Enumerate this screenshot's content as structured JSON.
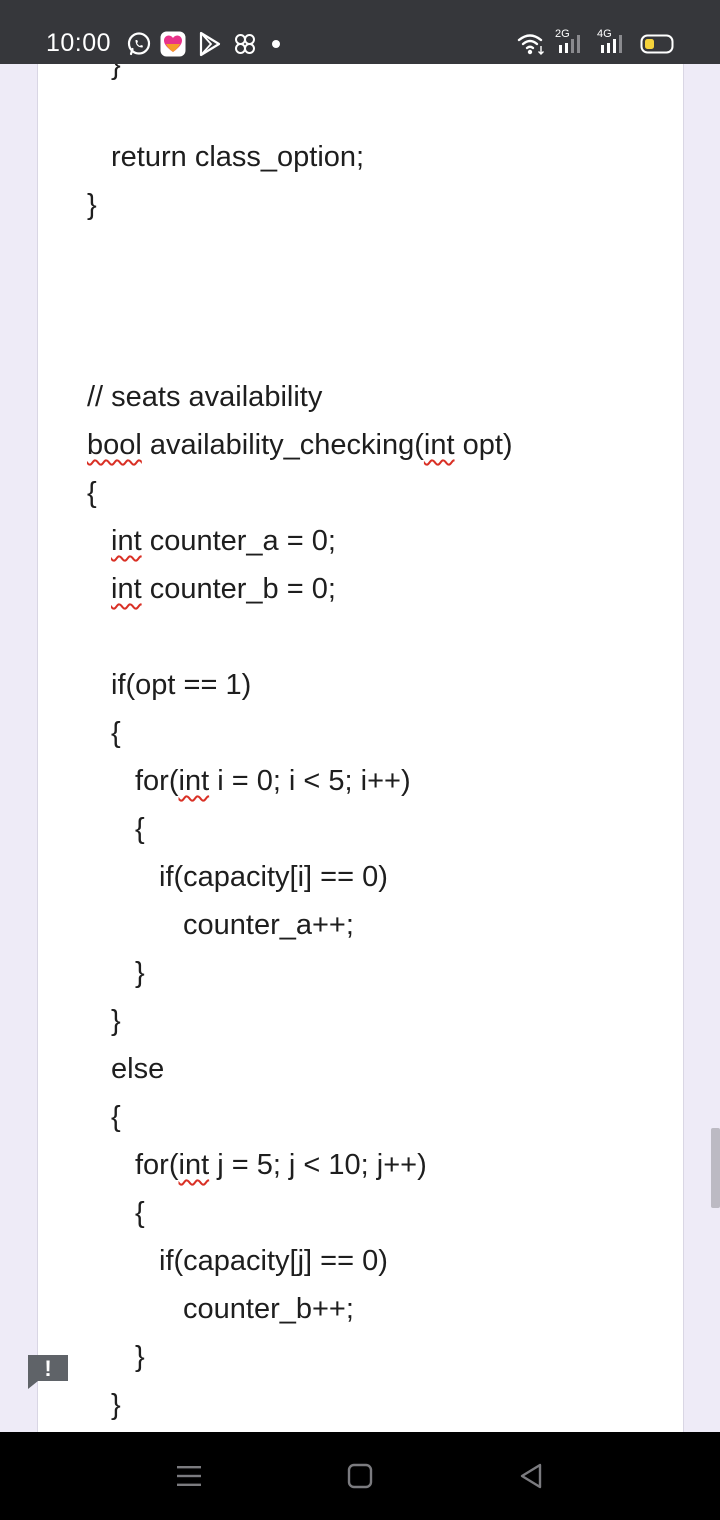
{
  "status_bar": {
    "time": "10:00",
    "left_icons": [
      "whatsapp-icon",
      "heart-app-icon",
      "play-store-icon",
      "pinwheel-icon",
      "dot-icon"
    ],
    "right_icons": [
      "wifi-icon",
      "signal-2g-icon",
      "signal-4g-icon",
      "battery-icon"
    ],
    "network_2g": "2G",
    "network_4g": "4G",
    "battery_color": "#f5d23b"
  },
  "document": {
    "lines": [
      {
        "text": "}"
      },
      {
        "text": "return class_option;"
      },
      {
        "text": "}"
      },
      {
        "text": "// seats availability"
      },
      {
        "a": "bool",
        "b": " availability_checking(",
        "c": "int",
        "d": " opt)"
      },
      {
        "text": "{"
      },
      {
        "a": "int",
        "b": " counter_a = 0;"
      },
      {
        "a": "int",
        "b": " counter_b = 0;"
      },
      {
        "text": "if(opt == 1)"
      },
      {
        "text": "{"
      },
      {
        "a": "for(",
        "b": "int",
        "c": " i = 0; i < 5; i++)"
      },
      {
        "text": "{"
      },
      {
        "text": "if(capacity[i] == 0)"
      },
      {
        "text": "counter_a++;"
      },
      {
        "text": "}"
      },
      {
        "text": "}"
      },
      {
        "text": "else"
      },
      {
        "text": "{"
      },
      {
        "a": "for(",
        "b": "int",
        "c": " j = 5; j < 10; j++)"
      },
      {
        "text": "{"
      },
      {
        "text": "if(capacity[j] == 0)"
      },
      {
        "text": "counter_b++;"
      },
      {
        "text": "}"
      },
      {
        "text": "}"
      }
    ],
    "spellcheck_color": "#d93025"
  },
  "feedback": {
    "label": "!",
    "color": "#5f6368"
  },
  "nav_bar": {
    "icons": [
      "recent-apps-icon",
      "home-icon",
      "back-icon"
    ]
  }
}
